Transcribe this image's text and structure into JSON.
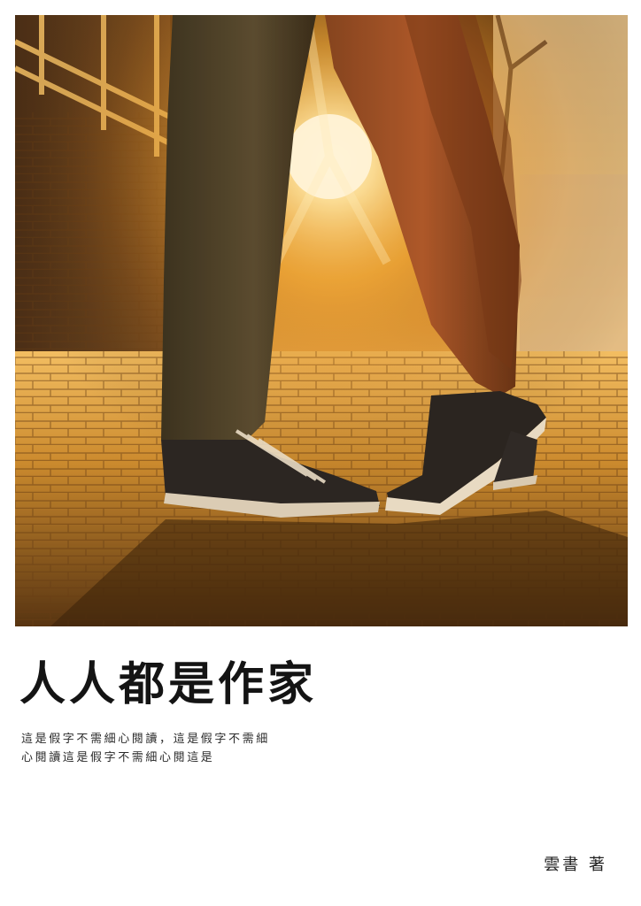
{
  "cover": {
    "title": "人人都是作家",
    "blurb_line_1": "這是假字不需細心閱讀，這是假字不需細",
    "blurb_line_2": "心閱讀這是假字不需細心閱這是",
    "author": "雲書 著"
  },
  "photo": {
    "subject": "two pairs of canvas sneakers touching on a brick sidewalk at sunset",
    "colors": {
      "sun": "#fff6d2",
      "glow": "#ffb23a",
      "shadow": "#1e140a",
      "brick": "#c58630"
    }
  }
}
